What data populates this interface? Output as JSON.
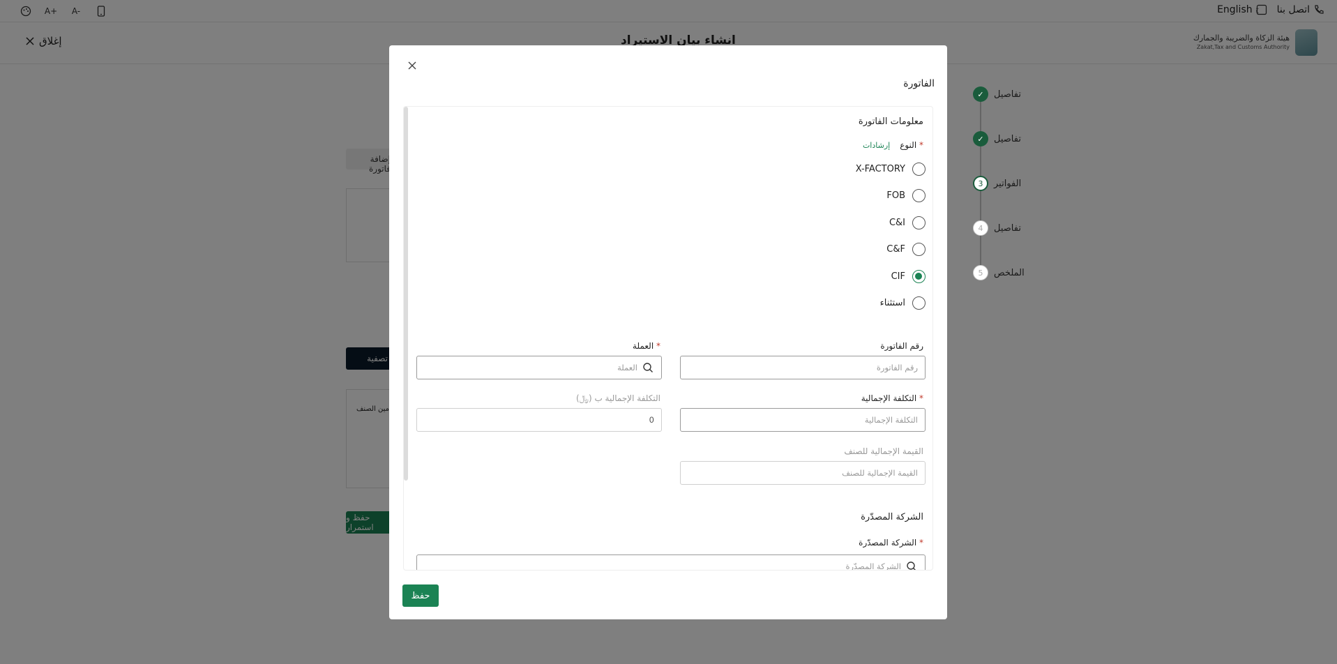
{
  "topbar": {
    "language_label": "English",
    "contact_label": "اتصل بنا",
    "tools": [
      {
        "name": "palette-icon",
        "glyph": "◐"
      },
      {
        "name": "font-increase-icon",
        "glyph": "A+"
      },
      {
        "name": "font-decrease-icon",
        "glyph": "A-"
      },
      {
        "name": "mobile-icon",
        "glyph": "▯"
      }
    ]
  },
  "header": {
    "close_label": "إغلاق",
    "page_title": "انشاء بيان الاستيراد",
    "logo_ar": "هيئة الزكاة والضريبة والجمارك",
    "logo_en": "Zakat,Tax and Customs Authority"
  },
  "stepper": {
    "steps": [
      {
        "label": "تفاصيل",
        "state": "done",
        "mark": "✓"
      },
      {
        "label": "تفاصيل",
        "state": "done",
        "mark": "✓"
      },
      {
        "label": "الفواتير",
        "state": "current",
        "mark": "3"
      },
      {
        "label": "تفاصيل",
        "state": "todo",
        "mark": "4"
      },
      {
        "label": "الملخص",
        "state": "todo",
        "mark": "5"
      }
    ]
  },
  "background": {
    "add_invoice_label": "إضافة فاتورة",
    "filter_label": "تصفية",
    "table_col_label": "تأمين الصنف",
    "continue_label": "حفظ و استمرار"
  },
  "modal": {
    "title": "الفاتورة",
    "section_invoice_info": "معلومات الفاتورة",
    "type_label": "النوع",
    "guidelines_link": "إرشادات",
    "type_options": [
      {
        "label": "X-FACTORY",
        "checked": false
      },
      {
        "label": "FOB",
        "checked": false
      },
      {
        "label": "C&I",
        "checked": false
      },
      {
        "label": "C&F",
        "checked": false
      },
      {
        "label": "CIF",
        "checked": true
      },
      {
        "label": "استثناء",
        "checked": false
      }
    ],
    "invoice_number": {
      "label": "رقم الفاتورة",
      "placeholder": "رقم الفاتورة"
    },
    "currency": {
      "label": "العملة",
      "placeholder": "العملة",
      "required": true
    },
    "total_cost": {
      "label": "التكلفة الإجمالية",
      "placeholder": "التكلفة الإجمالية",
      "required": true
    },
    "total_cost_in": {
      "label": "التكلفة الإجمالية ب (﷼)",
      "value": "0"
    },
    "item_total_value": {
      "label": "القيمة الإجمالية للصنف",
      "placeholder": "القيمة الإجمالية للصنف"
    },
    "section_exporter": "الشركة المصدّرة",
    "exporter": {
      "label": "الشركة المصدّرة",
      "placeholder": "الشركة المصدّرة",
      "required": true
    },
    "save_label": "حفظ"
  }
}
